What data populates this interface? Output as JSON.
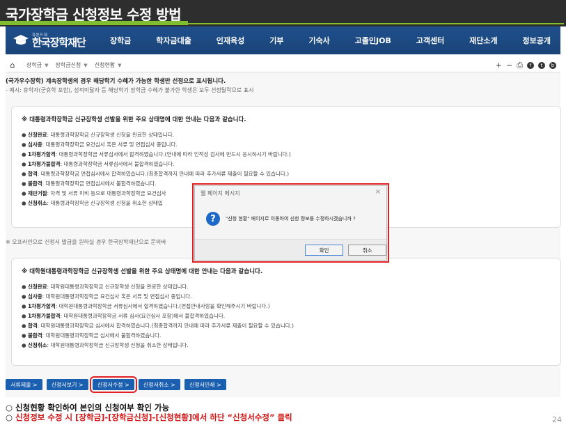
{
  "slide": {
    "title": "국가장학금 신청정보 수정 방법",
    "page_number": "24"
  },
  "nav": {
    "logo_small": "퓨톤드대",
    "logo_main": "한국장학재단",
    "items": [
      "장학금",
      "학자금대출",
      "인재육성",
      "기부",
      "기숙사",
      "고졸인JOB",
      "고객센터",
      "재단소개",
      "정보공개"
    ]
  },
  "breadcrumb": {
    "items": [
      "장학금",
      "장학금신청",
      "신청현황"
    ],
    "tools": [
      "+",
      "−"
    ]
  },
  "content": {
    "note1": "(국가우수장학) 계속장학생의 경우 해당학기 수혜가 가능한 학생만 선정으로 표시됩니다.",
    "note2": "- 예시: 휴학자(군휴학 포함), 성적미달자 등 해당학기 장학금 수혜가 불가한 학생은 모두 선정탈락으로 표시",
    "box1": {
      "heading": "※ 대통령과학장학금 신규장학생 선발을 위한 주요 상태명에 대한 안내는 다음과 같습니다.",
      "items": [
        {
          "term": "신청완료",
          "desc": ": 대통령과학장학금 신규장학생 신청을 완료한 상태입니다."
        },
        {
          "term": "심사중",
          "desc": ": 대통령과학장학금 요건심사 혹은 서류 및 면접심사 중입니다."
        },
        {
          "term": "1차평가합격",
          "desc": ": 대통령과학장학금 서류심사에서 합격하였습니다.(안내에 따라 인적성 검사에 반드시 응시하시기 바랍니다.)"
        },
        {
          "term": "1차평가불합격",
          "desc": ": 대통령과학장학금 서류심사에서 불합격하였습니다."
        },
        {
          "term": "합격",
          "desc": ": 대통령과학장학금 면접심사에서 합격하였습니다.(최종합격까지 안내에 따라 추가서류 제출이 필요할 수 있습니다.)"
        },
        {
          "term": "불합격",
          "desc": ": 대통령과학장학금 면접심사에서 불합격하였습니다."
        },
        {
          "term": "재단거절",
          "desc": ": 자격 및 서류 미비 등으로 대통령과학장학금 요건심사"
        },
        {
          "term": "신청취소",
          "desc": ": 대통령과학장학금 신규장학생 신청을 취소한 상태입"
        }
      ]
    },
    "offline_note": "※ 오프라인으로 신청서 발급을 원하실 경우 한국장학재단으로 문의바",
    "box2": {
      "heading": "※ 대학원대통령과학장학금 신규장학생 선발을 위한 주요 상태명에 대한 안내는 다음과 같습니다.",
      "items": [
        {
          "term": "신청완료",
          "desc": ": 대학원대통령과학장학금 신규장학생 신청을 완료한 상태입니다."
        },
        {
          "term": "심사중",
          "desc": ": 대학원대통령과학장학금 요건심사 혹은 서류 및 면접심사 중입니다."
        },
        {
          "term": "1차평가합격",
          "desc": ": 대학원대통령과학장학금 서류심사에서 합격하였습니다.(면접안내사항을 확인해주시기 바랍니다.)"
        },
        {
          "term": "1차평가불합격",
          "desc": ": 대학원대통령과학장학금 서류 심사(요건심사 포함)에서 불합격하였습니다."
        },
        {
          "term": "합격",
          "desc": ": 대학원대통령과학장학금 심사에서 합격하였습니다.(최종합격까지 안내에 따라 추가서류 제출이 필요할 수 있습니다.)"
        },
        {
          "term": "불합격",
          "desc": ": 대학원대통령과학장학금 심사에서 불합격하였습니다."
        },
        {
          "term": "신청취소",
          "desc": ": 대학원대통령과학장학금 신규장학생 신청을 취소한 상태입니다."
        }
      ]
    }
  },
  "dialog": {
    "title": "웹 페이지 메시지",
    "close": "×",
    "icon": "?",
    "message": "\"신청 현황\" 페이지로 이동하여 신청 정보를 수정하시겠습니까 ?",
    "ok": "확인",
    "cancel": "취소"
  },
  "buttons": [
    "서류제출 >",
    "신청서보기 >",
    "신청서수정 >",
    "신청서취소 >",
    "신청서인쇄 >"
  ],
  "captions": {
    "line1": "○ 신청현황 확인하여 본인의 신청여부 확인 가능",
    "line2_prefix": "○ ",
    "line2": "신청정보 수정 시 [장학금]-[장학금신청]-[신청현황]에서 하단 “신청서수정” 클릭"
  },
  "colors": {
    "nav_bg": "#1f4f8c",
    "accent_green": "#7fbf2f",
    "highlight_red": "#e02020",
    "button_blue": "#1b5fb0"
  }
}
